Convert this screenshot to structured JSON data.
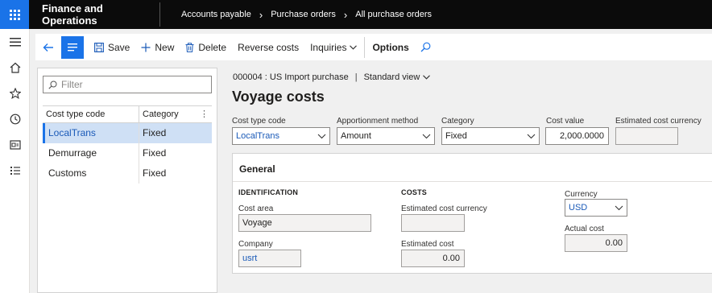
{
  "topbar": {
    "app_title": "Finance and Operations",
    "breadcrumbs": [
      "Accounts payable",
      "Purchase orders",
      "All purchase orders"
    ]
  },
  "leftnav": {
    "icons": [
      "hamburger-icon",
      "home-icon",
      "star-icon",
      "clock-icon",
      "workspace-icon",
      "list-icon"
    ]
  },
  "toolbar": {
    "save_label": "Save",
    "new_label": "New",
    "delete_label": "Delete",
    "reverse_label": "Reverse costs",
    "inquiries_label": "Inquiries",
    "options_label": "Options"
  },
  "filter": {
    "placeholder": "Filter"
  },
  "grid": {
    "headers": {
      "code": "Cost type code",
      "category": "Category"
    },
    "rows": [
      {
        "code": "LocalTrans",
        "category": "Fixed",
        "selected": true
      },
      {
        "code": "Demurrage",
        "category": "Fixed",
        "selected": false
      },
      {
        "code": "Customs",
        "category": "Fixed",
        "selected": false
      }
    ]
  },
  "record": {
    "id_line": "000004 : US Import purchase",
    "view": "Standard view",
    "title": "Voyage costs"
  },
  "header_fields": {
    "cost_type_code": {
      "label": "Cost type code",
      "value": "LocalTrans"
    },
    "apportionment": {
      "label": "Apportionment method",
      "value": "Amount"
    },
    "category": {
      "label": "Category",
      "value": "Fixed"
    },
    "cost_value": {
      "label": "Cost value",
      "value": "2,000.0000"
    },
    "est_cost_currency": {
      "label": "Estimated cost currency",
      "value": ""
    }
  },
  "general": {
    "title": "General",
    "identification": {
      "heading": "IDENTIFICATION",
      "cost_area_label": "Cost area",
      "cost_area_value": "Voyage",
      "company_label": "Company",
      "company_value": "usrt"
    },
    "costs": {
      "heading": "COSTS",
      "est_currency_label": "Estimated cost currency",
      "est_currency_value": "",
      "est_cost_label": "Estimated cost",
      "est_cost_value": "0.00"
    },
    "right": {
      "currency_label": "Currency",
      "currency_value": "USD",
      "actual_cost_label": "Actual cost",
      "actual_cost_value": "0.00"
    }
  },
  "colors": {
    "accent": "#1a73e8",
    "topbar_bg": "#0b0b0b",
    "selected_row": "#cfe0f5",
    "link": "#1a5ab8"
  }
}
